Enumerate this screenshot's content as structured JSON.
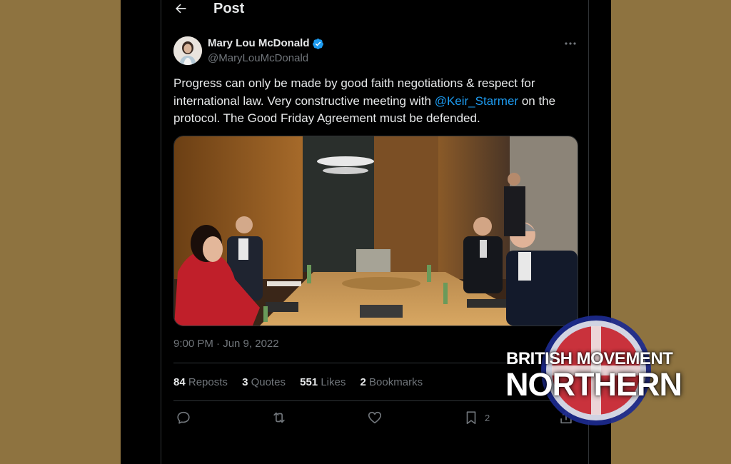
{
  "header": {
    "title": "Post",
    "back_icon": "arrow-left-icon"
  },
  "author": {
    "name": "Mary Lou McDonald",
    "handle": "@MaryLouMcDonald",
    "verified_icon": "verified-badge-icon",
    "verified_color": "#1d9bf0"
  },
  "tweet": {
    "text_before": "Progress can only be made by good faith negotiations & respect for international law. Very constructive meeting with ",
    "mention": "@Keir_Starmer",
    "text_after": " on the protocol. The Good Friday Agreement must be defended.",
    "timestamp": "9:00 PM · Jun 9, 2022"
  },
  "stats": [
    {
      "count": "84",
      "label": "Reposts"
    },
    {
      "count": "3",
      "label": "Quotes"
    },
    {
      "count": "551",
      "label": "Likes"
    },
    {
      "count": "2",
      "label": "Bookmarks"
    }
  ],
  "actions": {
    "reply_icon": "reply-icon",
    "repost_icon": "repost-icon",
    "like_icon": "heart-icon",
    "bookmark_icon": "bookmark-icon",
    "bookmark_count": "2",
    "share_icon": "share-icon"
  },
  "watermark": {
    "line1": "BRITISH MOVEMENT",
    "line2": "NORTHERN"
  },
  "colors": {
    "background_outer": "#8e7340",
    "panel": "#000000",
    "text_primary": "#e7e9ea",
    "text_secondary": "#71767b",
    "link": "#1d9bf0",
    "border": "#2f3336"
  }
}
